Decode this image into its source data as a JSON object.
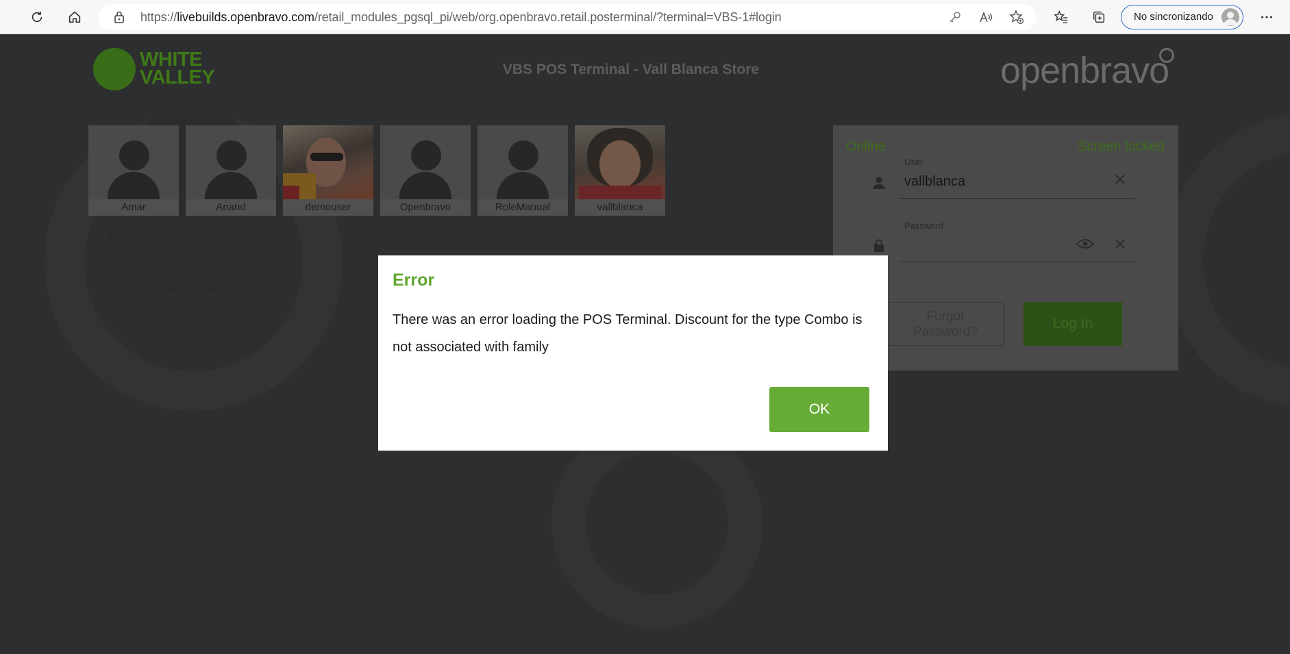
{
  "browser": {
    "url_prefix": "https://",
    "url_domain": "livebuilds.openbravo.com",
    "url_path": "/retail_modules_pgsql_pi/web/org.openbravo.retail.posterminal/?terminal=VBS-1#login",
    "sync_label": "No sincronizando",
    "icons": [
      "reload-icon",
      "home-icon",
      "lock-icon",
      "key-icon",
      "read-aloud-icon",
      "add-favorite-icon",
      "favorites-icon",
      "collections-icon",
      "profile-icon",
      "more-icon"
    ]
  },
  "header": {
    "brand_logo_text": "WHITE\nVALLEY",
    "terminal_title": "VBS POS Terminal - Vall Blanca Store",
    "vendor_logo_text": "openbravo"
  },
  "users": [
    {
      "name": "Amar",
      "avatar": "silhouette"
    },
    {
      "name": "Anand",
      "avatar": "silhouette"
    },
    {
      "name": "demouser",
      "avatar": "photo"
    },
    {
      "name": "Openbravo",
      "avatar": "silhouette"
    },
    {
      "name": "RoleManual",
      "avatar": "silhouette"
    },
    {
      "name": "vallblanca",
      "avatar": "photo"
    }
  ],
  "login": {
    "status_left": "Online",
    "status_right": "Screen locked",
    "user_label": "User",
    "user_value": "vallblanca",
    "password_label": "Password",
    "password_value": "",
    "forgot_label": "Forgot\nPassword?",
    "login_label": "Log In"
  },
  "dialog": {
    "title": "Error",
    "message": "There was an error loading the POS Terminal. Discount for the type Combo is not associated with family",
    "ok_label": "OK"
  },
  "colors": {
    "accent_green": "#67ac36",
    "overlay_dark": "#2d2e30"
  }
}
